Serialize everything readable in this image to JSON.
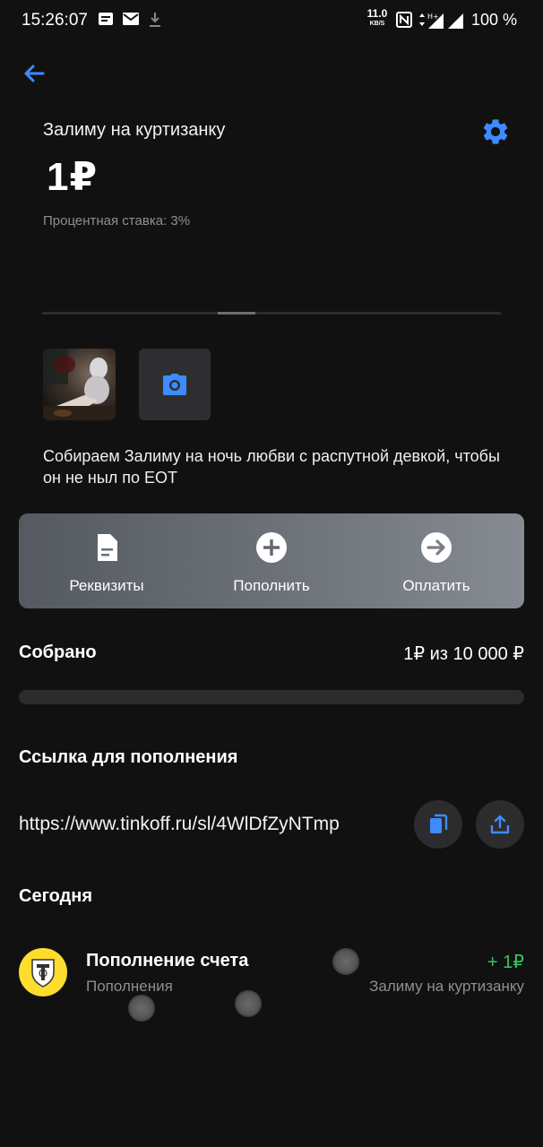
{
  "status_bar": {
    "time": "15:26:07",
    "net_speed": "11.0",
    "net_speed_unit": "KB/S",
    "battery": "100 %",
    "icons": [
      "message-icon",
      "mail-icon",
      "download-icon",
      "nfc-icon",
      "data-arrows-icon",
      "signal-h-plus-icon",
      "signal-icon"
    ]
  },
  "header": {
    "back_icon": "back-arrow-icon",
    "account_name": "Залиму на куртизанку",
    "settings_icon": "gear-icon",
    "balance": "1₽",
    "rate": "Процентная ставка: 3%"
  },
  "media": {
    "photo_alt": "photo-thumbnail",
    "camera_icon": "camera-icon"
  },
  "description": "Собираем Залиму на ночь любви с распутной девкой, чтобы он не ныл по ЕОТ",
  "actions": [
    {
      "label": "Реквизиты",
      "icon": "document-icon"
    },
    {
      "label": "Пополнить",
      "icon": "plus-circle-icon"
    },
    {
      "label": "Оплатить",
      "icon": "arrow-right-circle-icon"
    }
  ],
  "collected": {
    "label": "Собрано",
    "value": "1₽ из 10 000 ₽",
    "progress_fraction": 0.0001
  },
  "link": {
    "title": "Ссылка для пополнения",
    "url": "https://www.tinkoff.ru/sl/4WlDfZyNTmp",
    "copy_icon": "copy-icon",
    "share_icon": "share-icon"
  },
  "history": {
    "section_title": "Сегодня",
    "operations": [
      {
        "title": "Пополнение счета",
        "category": "Пополнения",
        "amount": "+ 1₽",
        "account": "Залиму на куртизанку",
        "icon": "tinkoff-logo-icon"
      }
    ]
  },
  "colors": {
    "background": "#111112",
    "accent_blue": "#3e8bff",
    "positive_green": "#34c759",
    "brand_yellow": "#ffdd2d",
    "secondary_text": "#8e8e93"
  }
}
